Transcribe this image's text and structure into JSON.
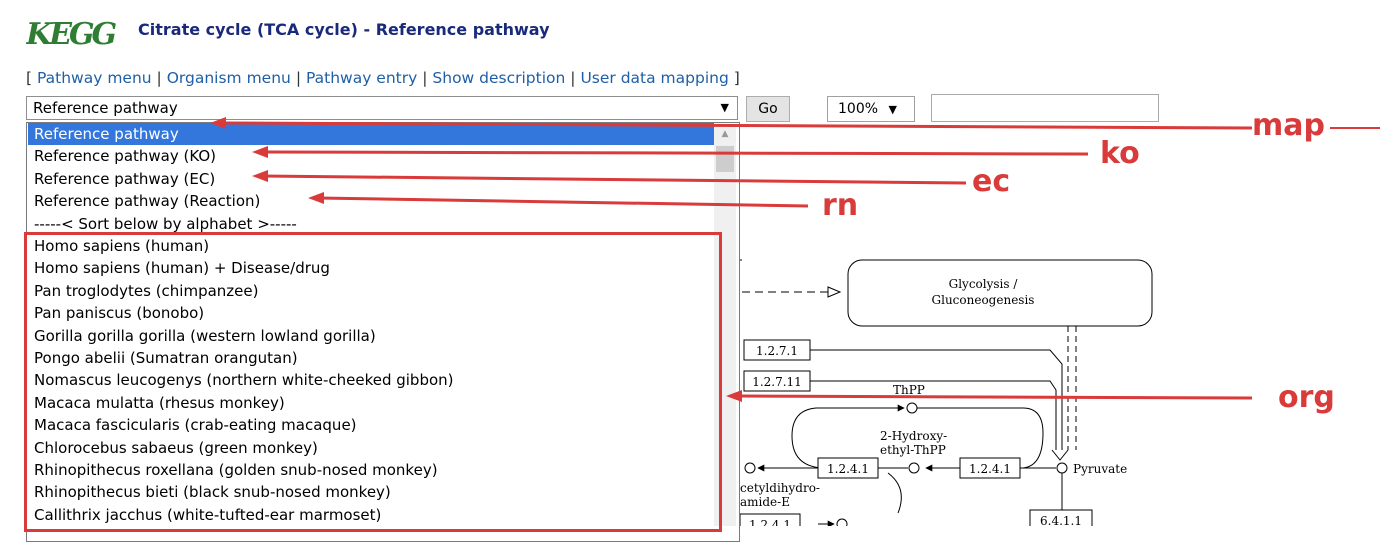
{
  "logo_text": "KEGG",
  "title": "Citrate cycle (TCA cycle) - Reference pathway",
  "menu": {
    "open_bracket": "[",
    "close_bracket": "]",
    "separator": "|",
    "items": [
      "Pathway menu",
      "Organism menu",
      "Pathway entry",
      "Show description",
      "User data mapping"
    ]
  },
  "select": {
    "value": "Reference pathway"
  },
  "go_label": "Go",
  "zoom": {
    "value": "100%"
  },
  "search": {
    "value": ""
  },
  "dropdown_options": [
    "Reference pathway",
    "Reference pathway (KO)",
    "Reference pathway (EC)",
    "Reference pathway (Reaction)",
    "-----< Sort below by alphabet >-----",
    "Homo sapiens (human)",
    "Homo sapiens (human) + Disease/drug",
    "Pan troglodytes (chimpanzee)",
    "Pan paniscus (bonobo)",
    "Gorilla gorilla gorilla (western lowland gorilla)",
    "Pongo abelii (Sumatran orangutan)",
    "Nomascus leucogenys (northern white-cheeked gibbon)",
    "Macaca mulatta (rhesus monkey)",
    "Macaca fascicularis (crab-eating macaque)",
    "Chlorocebus sabaeus (green monkey)",
    "Rhinopithecus roxellana (golden snub-nosed monkey)",
    "Rhinopithecus bieti (black snub-nosed monkey)",
    "Callithrix jacchus (white-tufted-ear marmoset)"
  ],
  "selected_index": 0,
  "annotations": {
    "map": "map",
    "ko": "ko",
    "ec": "ec",
    "rn": "rn",
    "org": "org"
  },
  "annotation_color": "#d93a3a",
  "pathway": {
    "glycolysis_line1": "Glycolysis /",
    "glycolysis_line2": "Gluconeogenesis",
    "ec_1271": "1.2.7.1",
    "ec_12711": "1.2.7.11",
    "ec_1241_a": "1.2.4.1",
    "ec_1241_b": "1.2.4.1",
    "ec_1241_c": "1.2.4.1",
    "ec_6411": "6.4.1.1",
    "thpp": "ThPP",
    "hydroxy_line1": "2-Hydroxy-",
    "hydroxy_line2": "ethyl-ThPP",
    "pyruvate": "Pyruvate",
    "acetyl_line1": "cetyldihydro-",
    "acetyl_line2": "amide-E"
  }
}
